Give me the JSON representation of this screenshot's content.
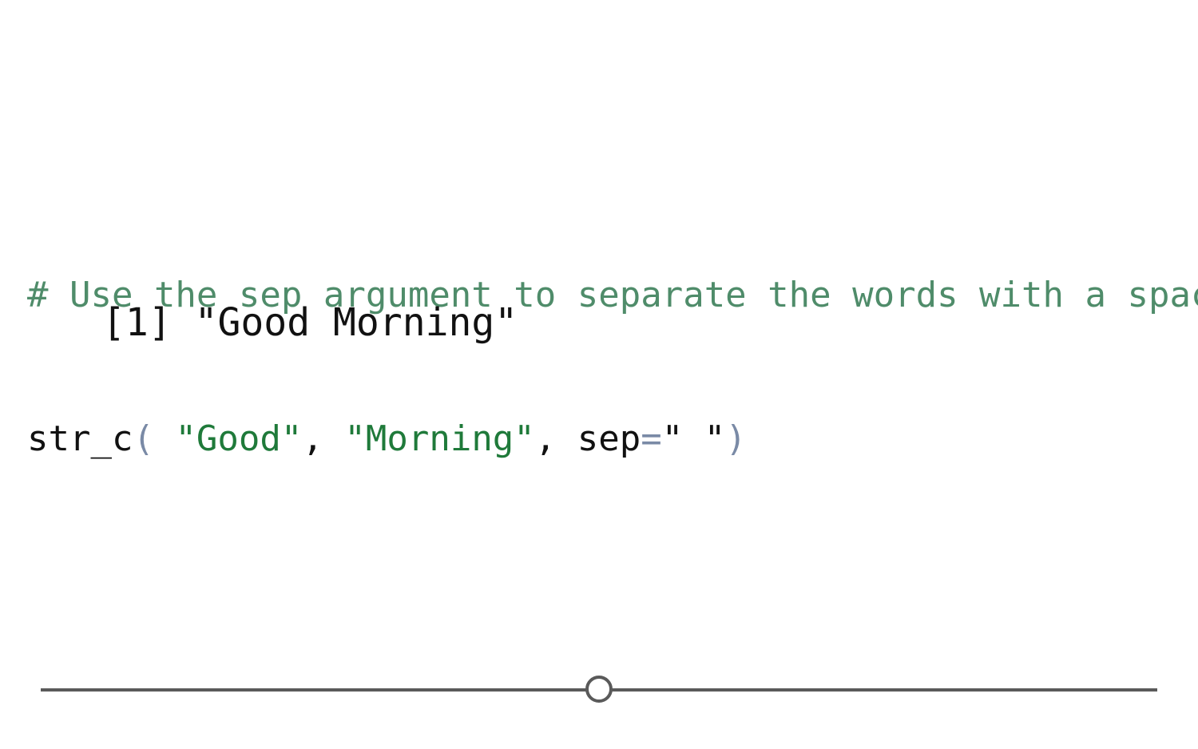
{
  "code": {
    "comment": "# Use the sep argument to separate the words with a space",
    "call": {
      "fn": "str_c",
      "open": "( ",
      "arg1": "\"Good\"",
      "comma1": ", ",
      "arg2": "\"Morning\"",
      "comma2": ", ",
      "sep_name": "sep",
      "sep_eq": "=",
      "sep_val": "\" \"",
      "close": ")"
    }
  },
  "output": {
    "index": "[1]",
    "value": "\"Good Morning\""
  },
  "player": {
    "progress": 0.5
  }
}
